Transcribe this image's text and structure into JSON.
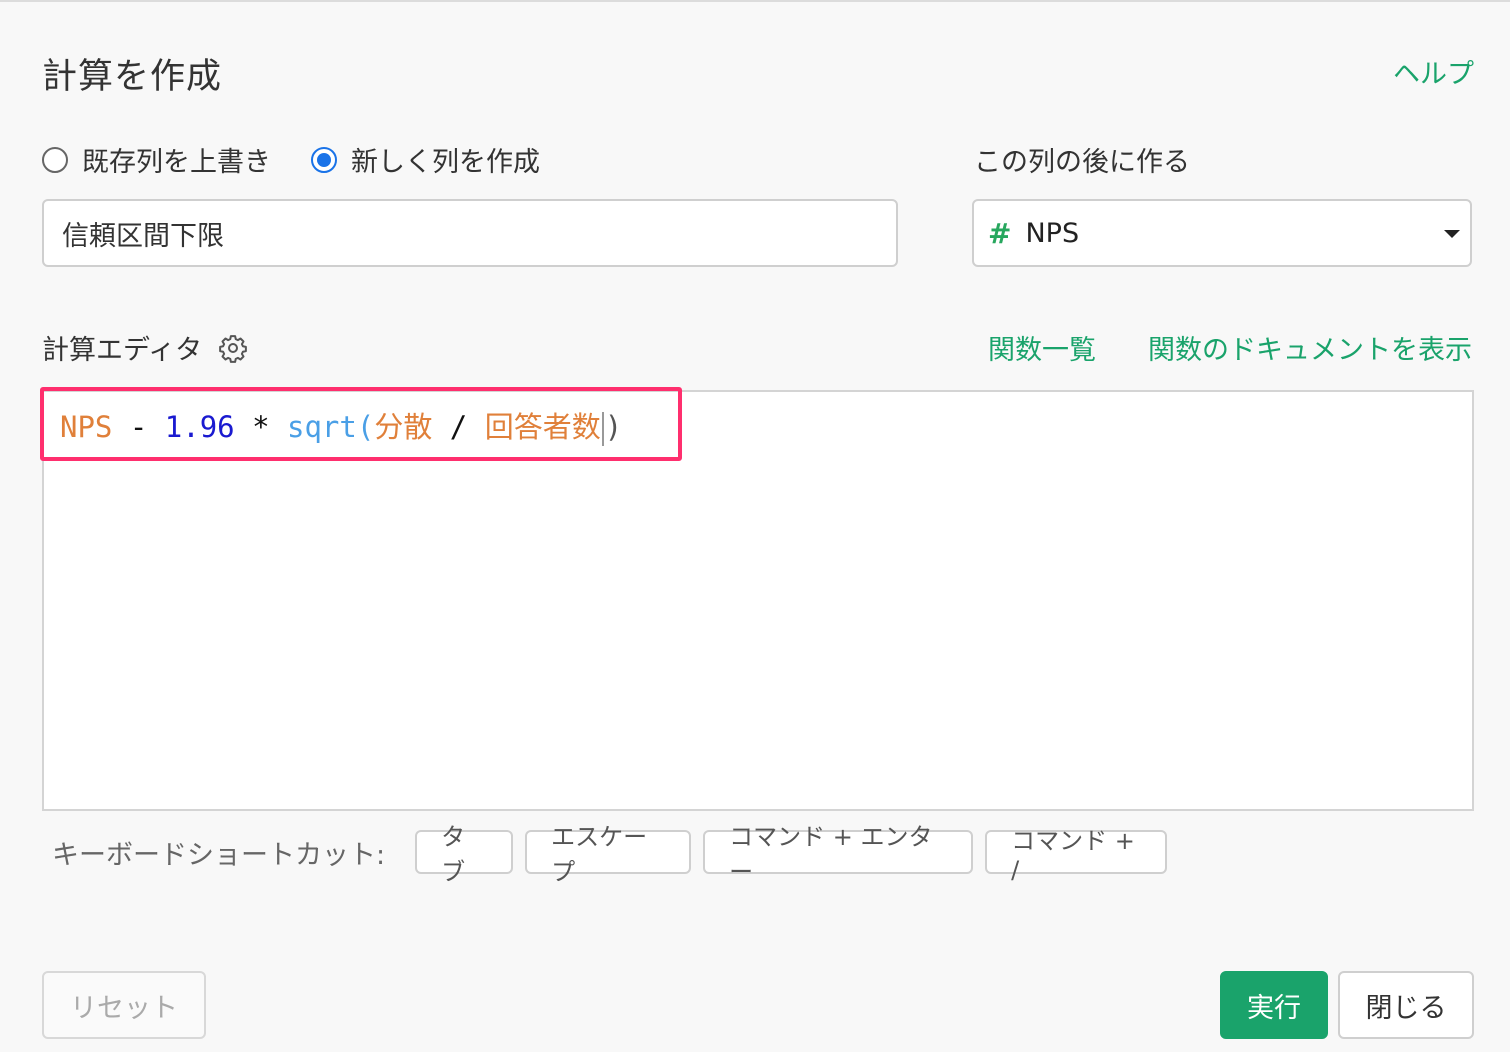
{
  "dialog": {
    "title": "計算を作成",
    "help_link": "ヘルプ"
  },
  "mode": {
    "options": [
      {
        "label": "既存列を上書き",
        "selected": false
      },
      {
        "label": "新しく列を作成",
        "selected": true
      }
    ]
  },
  "column_name": {
    "value": "信頼区間下限"
  },
  "position": {
    "label": "この列の後に作る",
    "selected_column": "NPS",
    "column_type_icon": "#"
  },
  "editor": {
    "label": "計算エディタ",
    "links": {
      "function_list": "関数一覧",
      "function_docs": "関数のドキュメントを表示"
    },
    "expression": {
      "t1": "NPS",
      "t2": " - ",
      "t3": "1.96",
      "t4": " * ",
      "t5": "sqrt",
      "t6": "(",
      "t7": "分散",
      "t8": " / ",
      "t9": "回答者数",
      "t10": ")"
    }
  },
  "shortcuts": {
    "label": "キーボードショートカット:",
    "keys": [
      "タブ",
      "エスケープ",
      "コマンド + エンター",
      "コマンド + /"
    ]
  },
  "buttons": {
    "reset": "リセット",
    "run": "実行",
    "close": "閉じる"
  },
  "colors": {
    "accent_green": "#1aa36b",
    "radio_blue": "#1a73e8",
    "highlight_pink": "#ff2f6e"
  }
}
